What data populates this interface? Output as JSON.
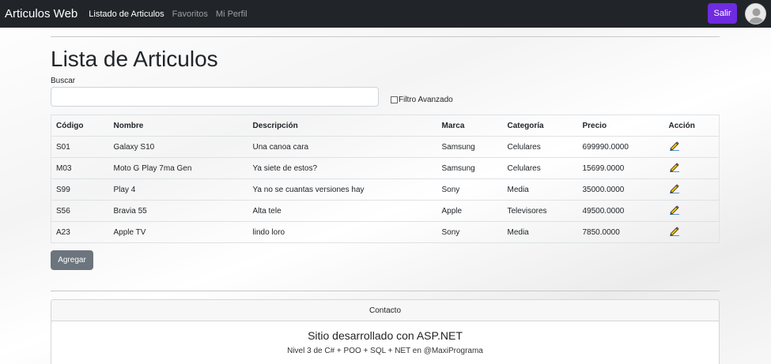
{
  "navbar": {
    "brand": "Articulos Web",
    "links": [
      {
        "label": "Listado de Articulos",
        "active": true
      },
      {
        "label": "Favoritos",
        "active": false
      },
      {
        "label": "Mi Perfil",
        "active": false
      }
    ],
    "logout_label": "Salir",
    "logout_color": "#6f2be0",
    "avatar_icon": "user-avatar-icon"
  },
  "main": {
    "title": "Lista de Articulos",
    "search_label": "Buscar",
    "search_value": "",
    "advanced_filter_label": "Filtro Avanzado",
    "advanced_filter_checked": false,
    "add_button_label": "Agregar"
  },
  "table": {
    "headers": [
      "Código",
      "Nombre",
      "Descripción",
      "Marca",
      "Categoría",
      "Precio",
      "Acción"
    ],
    "rows": [
      {
        "codigo": "S01",
        "nombre": "Galaxy S10",
        "descripcion": "Una canoa cara",
        "marca": "Samsung",
        "categoria": "Celulares",
        "precio": "699990.0000",
        "accion_icon": "pencil-icon"
      },
      {
        "codigo": "M03",
        "nombre": "Moto G Play 7ma Gen",
        "descripcion": "Ya siete de estos?",
        "marca": "Samsung",
        "categoria": "Celulares",
        "precio": "15699.0000",
        "accion_icon": "pencil-icon"
      },
      {
        "codigo": "S99",
        "nombre": "Play 4",
        "descripcion": "Ya no se cuantas versiones hay",
        "marca": "Sony",
        "categoria": "Media",
        "precio": "35000.0000",
        "accion_icon": "pencil-icon"
      },
      {
        "codigo": "S56",
        "nombre": "Bravia 55",
        "descripcion": "Alta tele",
        "marca": "Apple",
        "categoria": "Televisores",
        "precio": "49500.0000",
        "accion_icon": "pencil-icon"
      },
      {
        "codigo": "A23",
        "nombre": "Apple TV",
        "descripcion": "lindo loro",
        "marca": "Sony",
        "categoria": "Media",
        "precio": "7850.0000",
        "accion_icon": "pencil-icon"
      }
    ]
  },
  "footer": {
    "header": "Contacto",
    "title": "Sitio desarrollado con ASP.NET",
    "text": "Nivel 3 de C# + POO + SQL + NET en @MaxiPrograma"
  }
}
